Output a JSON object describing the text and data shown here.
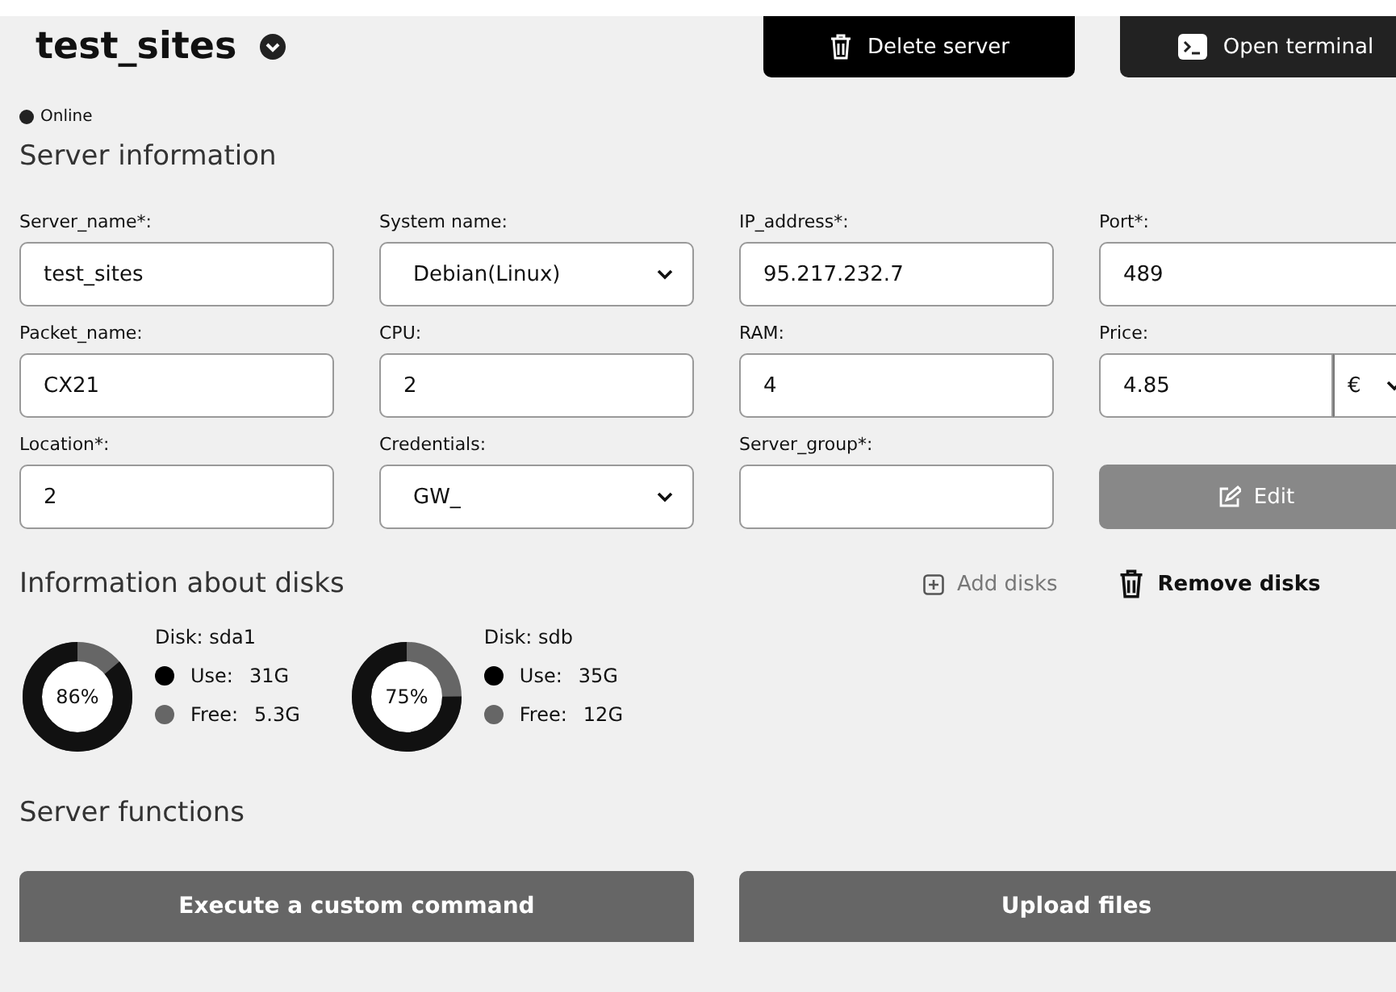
{
  "header": {
    "title": "test_sites",
    "buttons": [
      {
        "label": "Delete server",
        "kind": "delete"
      },
      {
        "label": "Open terminal",
        "kind": "terminal"
      }
    ]
  },
  "status": {
    "label": "Online",
    "online": true
  },
  "server_information": {
    "title": "Server information",
    "fields": [
      {
        "label": "Server_name*:",
        "kind": "input",
        "value": "test_sites"
      },
      {
        "label": "System name:",
        "kind": "select",
        "value": "Debian(Linux)"
      },
      {
        "label": "IP_address*:",
        "kind": "input",
        "value": "95.217.232.7"
      },
      {
        "label": "Port*:",
        "kind": "input",
        "value": "489"
      },
      {
        "label": "Packet_name:",
        "kind": "input",
        "value": "CX21"
      },
      {
        "label": "CPU:",
        "kind": "input",
        "value": "2"
      },
      {
        "label": "RAM:",
        "kind": "input",
        "value": "4"
      },
      {
        "label": "Price:",
        "kind": "price",
        "value": "4.85",
        "currency": "€"
      },
      {
        "label": "Location*:",
        "kind": "input",
        "value": "2"
      },
      {
        "label": "Credentials:",
        "kind": "select",
        "value": "GW_"
      },
      {
        "label": "Server_group*:",
        "kind": "input"
      }
    ],
    "edit_button": {
      "label": "Edit",
      "disabled": true
    }
  },
  "disks": {
    "title": "Information about disks",
    "add_label": "Add disks",
    "remove_label": "Remove disks",
    "items": [
      {
        "name": "Disk: sda1",
        "percent": "86%",
        "level": 0.86,
        "use_label": "Use:",
        "use": "31G",
        "free_label": "Free:",
        "free": "5.3G"
      },
      {
        "name": "Disk: sdb",
        "percent": "75%",
        "level": 0.75,
        "use_label": "Use:",
        "use": "35G",
        "free_label": "Free:",
        "free": "12G"
      }
    ]
  },
  "server_functions": {
    "title": "Server functions",
    "buttons": [
      "Execute a custom command",
      "Upload files"
    ]
  }
}
